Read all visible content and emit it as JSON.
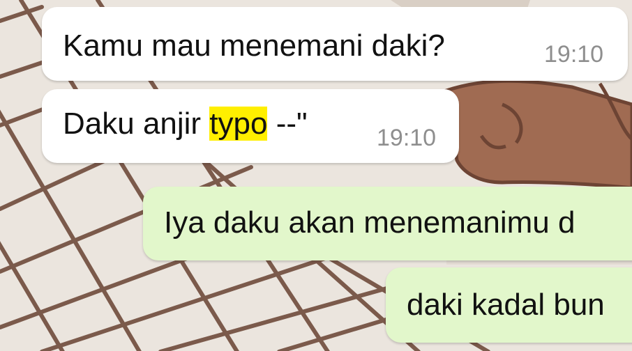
{
  "conversation": {
    "messages": [
      {
        "direction": "incoming",
        "text": "Kamu mau menemani daki?",
        "time": "19:10"
      },
      {
        "direction": "incoming",
        "text_before": "Daku anjir ",
        "text_highlight": "typo",
        "text_after": " --\"",
        "time": "19:10"
      },
      {
        "direction": "outgoing",
        "text": "Iya daku akan menemanimu d"
      },
      {
        "direction": "outgoing",
        "text": "daki kadal bun"
      }
    ]
  },
  "colors": {
    "incoming_bubble": "#ffffff",
    "outgoing_bubble": "#e2f7cb",
    "highlight": "#ffef00",
    "timestamp": "#8e8e8e",
    "wallpaper_line": "#7a5a4a"
  }
}
